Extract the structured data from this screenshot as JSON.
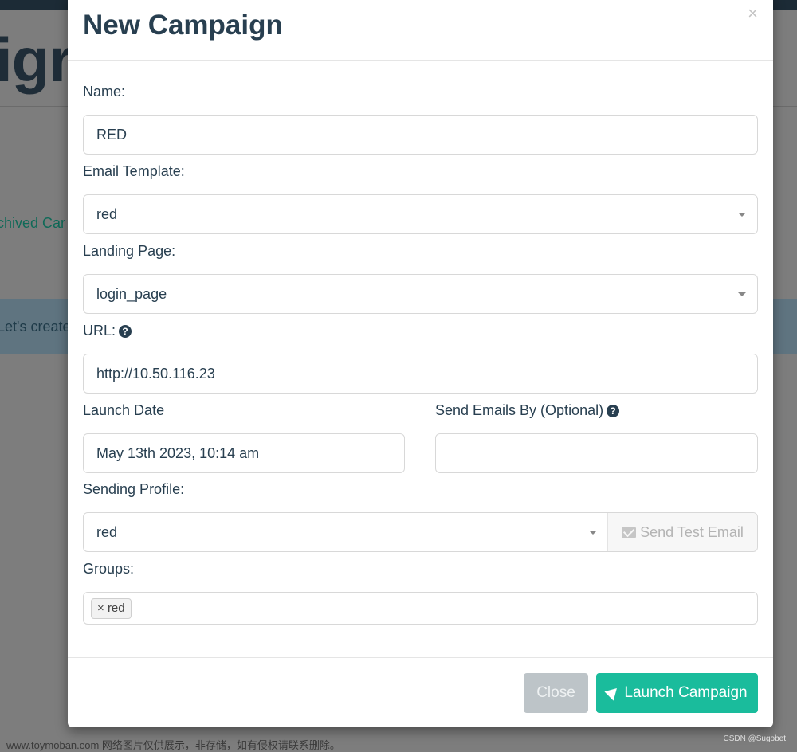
{
  "background": {
    "title_fragment": "igr",
    "tab_fragment": "chived Car",
    "alert_fragment": "Let's create",
    "footer_left": "www.toymoban.com 网络图片仅供展示，非存储，如有侵权请联系删除。",
    "footer_right": "CSDN @Sugobet"
  },
  "modal": {
    "title": "New Campaign",
    "close_symbol": "×",
    "name": {
      "label": "Name:",
      "value": "RED"
    },
    "email_template": {
      "label": "Email Template:",
      "value": "red"
    },
    "landing_page": {
      "label": "Landing Page:",
      "value": "login_page"
    },
    "url": {
      "label": "URL:",
      "value": "http://10.50.116.23",
      "help_icon": "?"
    },
    "launch_date": {
      "label": "Launch Date",
      "value": "May 13th 2023, 10:14 am"
    },
    "send_by": {
      "label": "Send Emails By (Optional)",
      "value": "",
      "help_icon": "?"
    },
    "sending_profile": {
      "label": "Sending Profile:",
      "value": "red",
      "test_button": "Send Test Email"
    },
    "groups": {
      "label": "Groups:",
      "tags": [
        {
          "remove": "×",
          "label": "red"
        }
      ]
    },
    "buttons": {
      "close": "Close",
      "launch": "Launch Campaign"
    }
  }
}
